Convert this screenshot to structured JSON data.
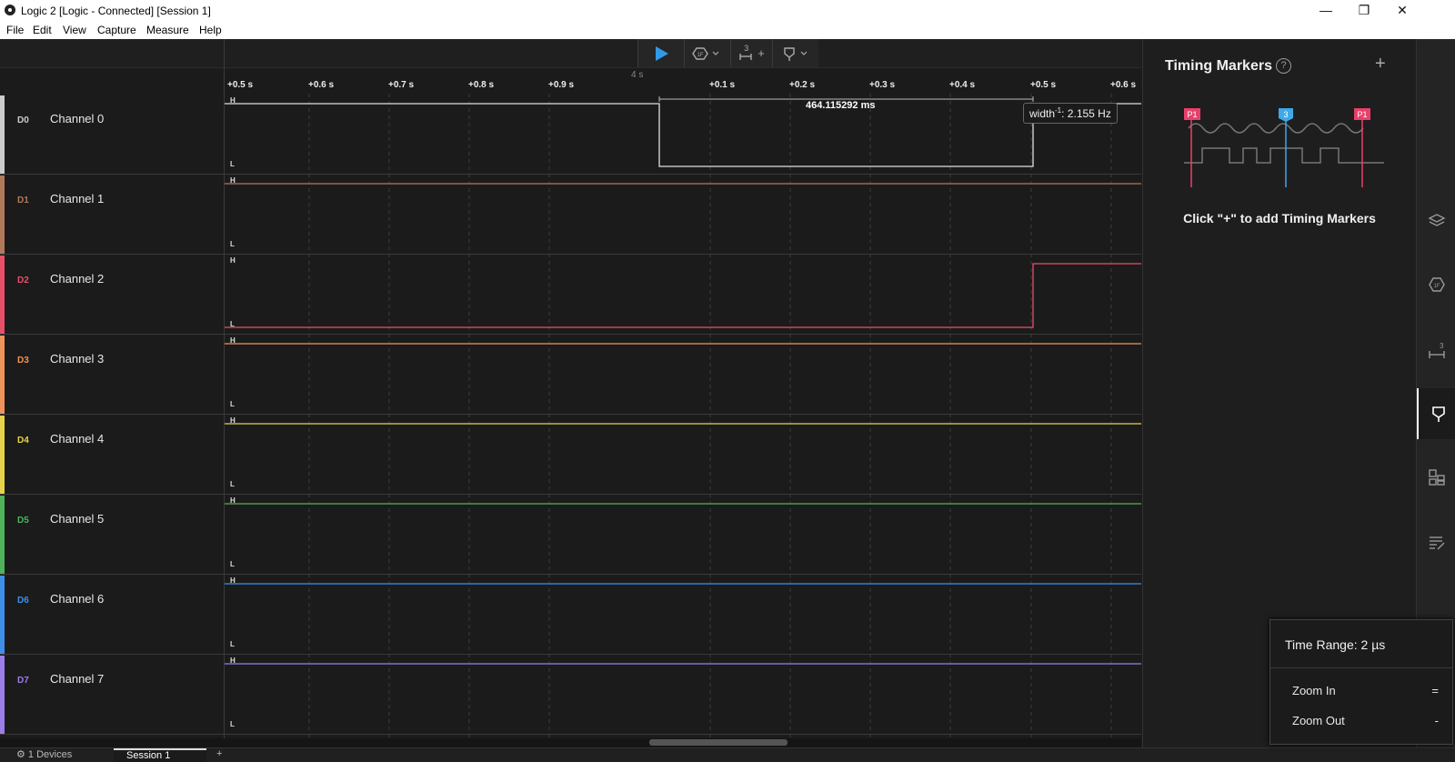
{
  "window": {
    "title": "Logic 2 [Logic - Connected] [Session 1]",
    "minimize": "—",
    "restore": "❐",
    "close": "✕"
  },
  "menu": [
    "File",
    "Edit",
    "View",
    "Capture",
    "Measure",
    "Help"
  ],
  "toolbar": {
    "play_icon": "play-icon",
    "analyzer_icon": "analyzer-icon",
    "measure_label": "3",
    "measure_plus": "+",
    "marker_icon": "marker-icon"
  },
  "ruler": {
    "center_label": "4 s",
    "ticks": [
      "+0.5 s",
      "+0.6 s",
      "+0.7 s",
      "+0.8 s",
      "+0.9 s",
      "+0.1 s",
      "+0.2 s",
      "+0.3 s",
      "+0.4 s",
      "+0.5 s",
      "+0.6 s"
    ]
  },
  "channels": [
    {
      "tag": "D0",
      "name": "Channel 0",
      "color": "#cccccc"
    },
    {
      "tag": "D1",
      "name": "Channel 1",
      "color": "#b07a5a"
    },
    {
      "tag": "D2",
      "name": "Channel 2",
      "color": "#e8506a"
    },
    {
      "tag": "D3",
      "name": "Channel 3",
      "color": "#f0935a"
    },
    {
      "tag": "D4",
      "name": "Channel 4",
      "color": "#e8d24a"
    },
    {
      "tag": "D5",
      "name": "Channel 5",
      "color": "#4fb35a"
    },
    {
      "tag": "D6",
      "name": "Channel 6",
      "color": "#3f8fe8"
    },
    {
      "tag": "D7",
      "name": "Channel 7",
      "color": "#9b7ee8"
    }
  ],
  "level_labels": {
    "high": "H",
    "low": "L"
  },
  "measurement": {
    "width": "464.115292 ms",
    "tooltip_prefix": "width",
    "tooltip_sup": "-1",
    "tooltip_value": ": 2.155 Hz"
  },
  "panel": {
    "title": "Timing Markers",
    "help": "?",
    "add": "+",
    "hint": "Click \"+\" to add Timing Markers",
    "marker_labels": [
      "P1",
      "3",
      "P1"
    ]
  },
  "zoom_popup": {
    "time_range": "Time Range: 2 µs",
    "zoom_in": "Zoom In",
    "zoom_in_key": "=",
    "zoom_out": "Zoom Out",
    "zoom_out_key": "-"
  },
  "tabs": {
    "devices": "⚙ 1 Devices",
    "session": "Session 1",
    "add": "+"
  },
  "sidebar_icons": [
    "analyzers-icon",
    "extensions-icon",
    "measurements-icon",
    "timing-markers-icon",
    "layout-icon",
    "notes-icon"
  ]
}
